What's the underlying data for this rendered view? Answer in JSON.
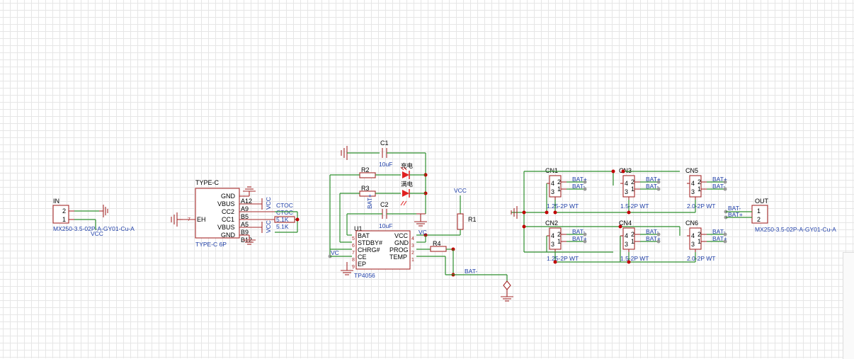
{
  "connector_in": {
    "ref": "IN",
    "part": "MX250-3.5-02P-A-GY01-Cu-A",
    "net": "VCC",
    "pins": [
      "2",
      "1"
    ]
  },
  "type_c": {
    "ref": "TYPE-C",
    "value": "TYPE-C 6P",
    "eh_pin": "7",
    "eh_label": "EH",
    "pins": [
      {
        "name": "GND",
        "num": "A12"
      },
      {
        "name": "VBUS",
        "num": "A9"
      },
      {
        "name": "CC2",
        "num": "B5"
      },
      {
        "name": "CC1",
        "num": "A5"
      },
      {
        "name": "VBUS",
        "num": "B9"
      },
      {
        "name": "GND",
        "num": "B12"
      }
    ],
    "vcc_labels": [
      "VCC",
      "VCC"
    ],
    "ctoc_labels": [
      "CTOC",
      "CTOC"
    ],
    "res_values": [
      "5.1K",
      "5.1K"
    ]
  },
  "tp4056": {
    "ref": "U1",
    "value": "TP4056",
    "left_pins": [
      {
        "name": "BAT",
        "num": "5"
      },
      {
        "name": "STDBY#",
        "num": "6"
      },
      {
        "name": "CHRG#",
        "num": "7"
      },
      {
        "name": "CE",
        "num": "8"
      },
      {
        "name": "EP",
        "num": "9"
      }
    ],
    "right_pins": [
      {
        "name": "VCC",
        "num": "4"
      },
      {
        "name": "GND",
        "num": "3"
      },
      {
        "name": "PROG",
        "num": "2"
      },
      {
        "name": "TEMP",
        "num": "1"
      }
    ],
    "c1": {
      "ref": "C1",
      "value": "10uF"
    },
    "c2": {
      "ref": "C2",
      "value": "10uF"
    },
    "r2": "R2",
    "r3": "R3",
    "r1": "R1",
    "r4": "R4",
    "led1": "充电",
    "led2": "满电",
    "net_vcc": "VCC",
    "net_vc_left": "VC",
    "net_vc_right": "VC",
    "net_bat_plus": "BAT+",
    "net_bat_minus": "BAT-"
  },
  "batteries": [
    {
      "ref": "CN1",
      "value": "1.25-2P WT",
      "labels": [
        "BAT+",
        "BAT-"
      ]
    },
    {
      "ref": "CN3",
      "value": "1.5-2P WT",
      "labels": [
        "BAT+",
        "BAT-"
      ]
    },
    {
      "ref": "CN5",
      "value": "2.0-2P WT",
      "labels": [
        "BAT+",
        "BAT-"
      ]
    },
    {
      "ref": "CN2",
      "value": "1.25-2P WT",
      "labels": [
        "BAT-",
        "BAT+"
      ]
    },
    {
      "ref": "CN4",
      "value": "1.5-2P WT",
      "labels": [
        "BAT-",
        "BAT+"
      ]
    },
    {
      "ref": "CN6",
      "value": "2.0-2P WT",
      "labels": [
        "BAT-",
        "BAT+"
      ]
    }
  ],
  "battery_pin_nums": [
    "4",
    "3",
    "2",
    "1"
  ],
  "connector_out": {
    "ref": "OUT",
    "part": "MX250-3.5-02P-A-GY01-Cu-A",
    "labels": [
      "BAT-",
      "BAT+"
    ],
    "pins": [
      "1",
      "2"
    ]
  }
}
